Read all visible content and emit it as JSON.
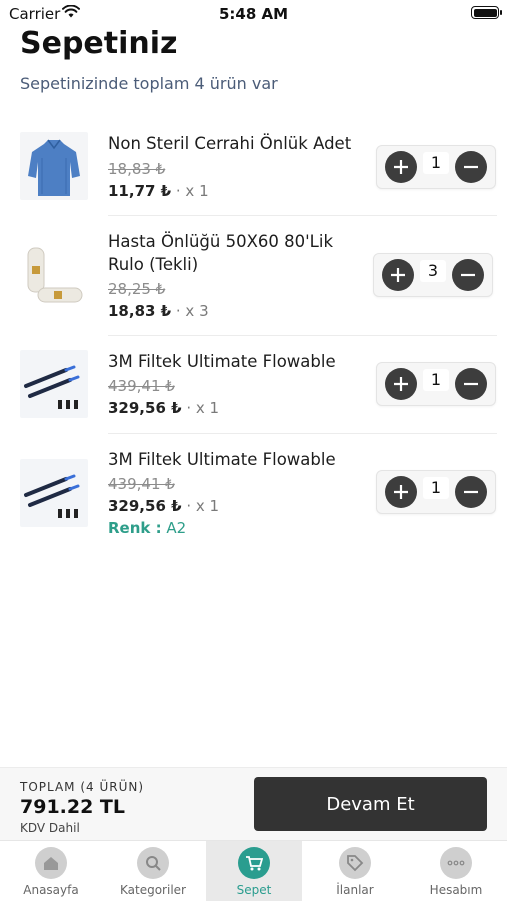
{
  "status_bar": {
    "carrier": "Carrier",
    "time": "5:48 AM"
  },
  "header": {
    "title": "Sepetiniz",
    "subtitle": "Sepetinizinde toplam 4 ürün var"
  },
  "cart_items": [
    {
      "name": "Non Steril Cerrahi Önlük Adet",
      "old_price": "18,83 ₺",
      "price": "11,77 ₺",
      "qty_text": "· x 1",
      "quantity": "1",
      "image": "surgical-gown"
    },
    {
      "name": "Hasta Önlüğü 50X60 80'Lik Rulo (Tekli)",
      "old_price": "28,25 ₺",
      "price": "18,83 ₺",
      "qty_text": "· x 3",
      "quantity": "3",
      "image": "paper-roll"
    },
    {
      "name": "3M Filtek Ultimate Flowable",
      "old_price": "439,41 ₺",
      "price": "329,56 ₺",
      "qty_text": "· x 1",
      "quantity": "1",
      "image": "syringes"
    },
    {
      "name": "3M Filtek Ultimate Flowable",
      "old_price": "439,41 ₺",
      "price": "329,56 ₺",
      "qty_text": "· x 1",
      "quantity": "1",
      "image": "syringes",
      "variant_label": "Renk :",
      "variant_value": "A2"
    }
  ],
  "footer": {
    "total_label": "TOPLAM (4 ÜRÜN)",
    "total_amount": "791.22 TL",
    "tax_note": "KDV Dahil",
    "continue_label": "Devam Et"
  },
  "tabbar": {
    "items": [
      {
        "label": "Anasayfa",
        "icon": "home-icon"
      },
      {
        "label": "Kategoriler",
        "icon": "categories-icon"
      },
      {
        "label": "Sepet",
        "icon": "cart-icon",
        "active": true
      },
      {
        "label": "İlanlar",
        "icon": "tag-icon"
      },
      {
        "label": "Hesabım",
        "icon": "more-icon"
      }
    ]
  },
  "colors": {
    "accent": "#2a9d8f",
    "button_dark": "#333333",
    "subtitle": "#4b5c78"
  }
}
